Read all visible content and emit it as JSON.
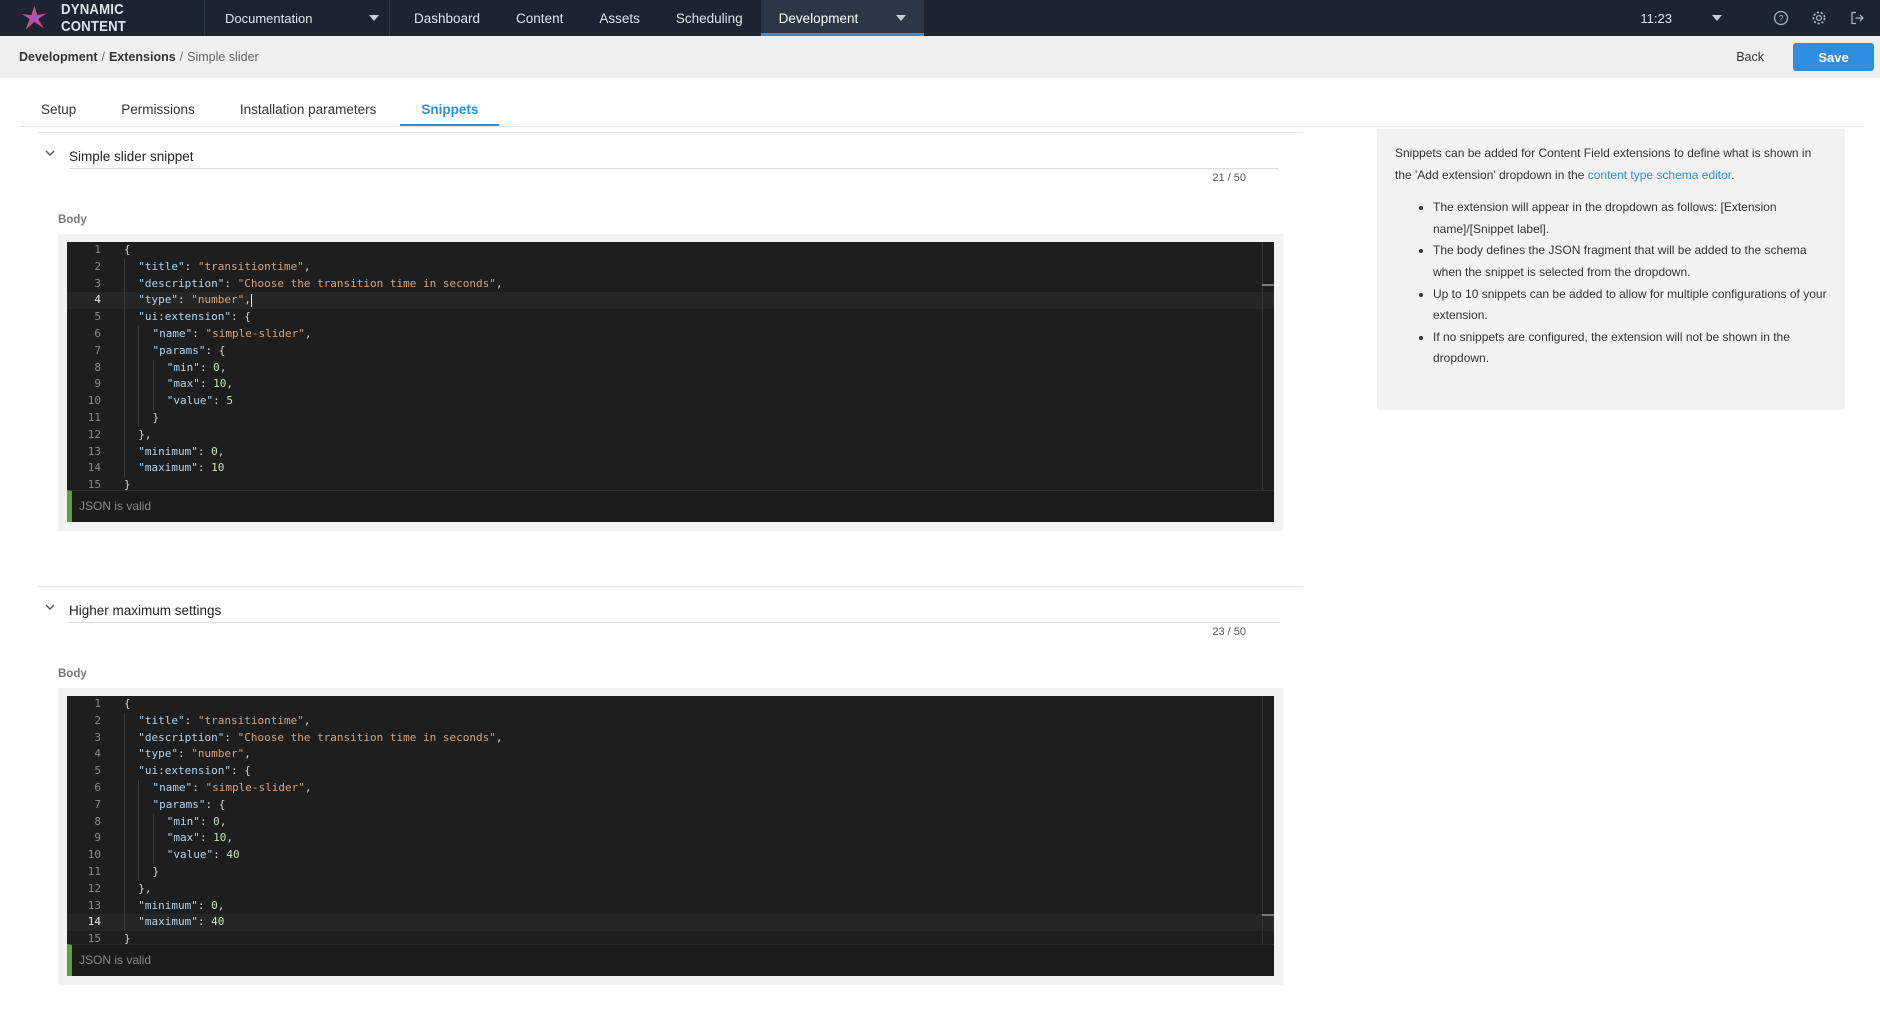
{
  "app": {
    "name": "DYNAMIC CONTENT"
  },
  "topbar": {
    "hub": "Documentation",
    "nav": [
      "Dashboard",
      "Content",
      "Assets",
      "Scheduling"
    ],
    "active_nav": "Development",
    "time": "11:23",
    "icons": [
      "help-icon",
      "settings-icon",
      "logout-icon"
    ]
  },
  "breadcrumb": {
    "root": "Development",
    "section": "Extensions",
    "current": "Simple slider",
    "separator": "/"
  },
  "actions": {
    "back": "Back",
    "save": "Save"
  },
  "tabs": [
    {
      "label": "Setup",
      "active": false
    },
    {
      "label": "Permissions",
      "active": false
    },
    {
      "label": "Installation parameters",
      "active": false
    },
    {
      "label": "Snippets",
      "active": true
    }
  ],
  "snippets": [
    {
      "label": "Simple slider snippet",
      "counter": "21 / 50",
      "body_label": "Body",
      "status": "JSON is valid",
      "current_line": 4,
      "lines": [
        "{",
        "  \"title\": \"transitiontime\",",
        "  \"description\": \"Choose the transition time in seconds\",",
        "  \"type\": \"number\",",
        "  \"ui:extension\": {",
        "    \"name\": \"simple-slider\",",
        "    \"params\": {",
        "      \"min\": 0,",
        "      \"max\": 10,",
        "      \"value\": 5",
        "    }",
        "  },",
        "  \"minimum\": 0,",
        "  \"maximum\": 10",
        "}"
      ]
    },
    {
      "label": "Higher maximum settings",
      "counter": "23 / 50",
      "body_label": "Body",
      "status": "JSON is valid",
      "current_line": 14,
      "lines": [
        "{",
        "  \"title\": \"transitiontime\",",
        "  \"description\": \"Choose the transition time in seconds\",",
        "  \"type\": \"number\",",
        "  \"ui:extension\": {",
        "    \"name\": \"simple-slider\",",
        "    \"params\": {",
        "      \"min\": 0,",
        "      \"max\": 10,",
        "      \"value\": 40",
        "    }",
        "  },",
        "  \"minimum\": 0,",
        "  \"maximum\": 40",
        "}"
      ]
    }
  ],
  "help": {
    "intro_before_link": "Snippets can be added for Content Field extensions to define what is shown in the 'Add extension' dropdown in the ",
    "link": "content type schema editor",
    "intro_after_link": ".",
    "bullets": [
      "The extension will appear in the dropdown as follows: [Extension name]/[Snippet label].",
      "The body defines the JSON fragment that will be added to the schema when the snippet is selected from the dropdown.",
      "Up to 10 snippets can be added to allow for multiple configurations of your extension.",
      "If no snippets are configured, the extension will not be shown in the dropdown."
    ]
  },
  "colors": {
    "nav_bg": "#1c2431",
    "accent": "#2d8de0",
    "valid": "#5aa43a",
    "editor_bg": "#1e1e1e"
  }
}
